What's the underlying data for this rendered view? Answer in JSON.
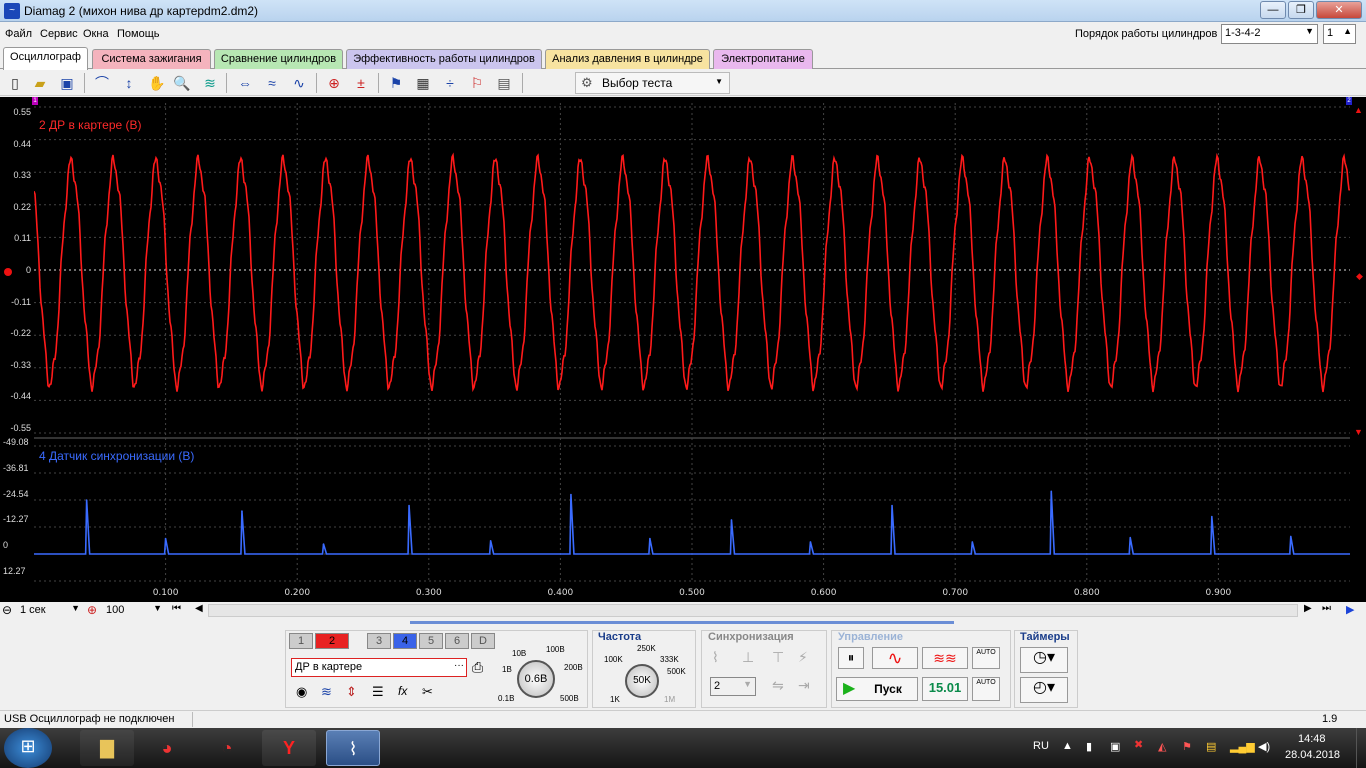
{
  "window": {
    "title": "Diamag 2 (михон нива др картерdm2.dm2)",
    "min_label": "—",
    "max_label": "❐",
    "close_label": "✕"
  },
  "menu": {
    "items": [
      "Файл",
      "Сервис",
      "Окна",
      "Помощь"
    ],
    "cylinder_order_label": "Порядок работы цилиндров",
    "cylinder_order_value": "1-3-4-2",
    "cylinder_number": "1"
  },
  "tabs": [
    {
      "label": "Осциллограф",
      "color": "#ffffff",
      "active": true
    },
    {
      "label": "Система зажигания",
      "color": "#f4b3bd"
    },
    {
      "label": "Сравнение цилиндров",
      "color": "#b7e7b3"
    },
    {
      "label": "Эффективность работы цилиндров",
      "color": "#cbc5ee"
    },
    {
      "label": "Анализ давления в цилиндре",
      "color": "#f7e3a0"
    },
    {
      "label": "Электропитание",
      "color": "#e9b8ee"
    }
  ],
  "toolbar": {
    "test_select": "Выбор теста",
    "icons": [
      "new-file-icon",
      "open-folder-icon",
      "save-icon",
      "channel-scale-icon",
      "cursor-icon",
      "hand-tool-icon",
      "zoom-icon",
      "signal-icon",
      "marker-icon",
      "filter-icon",
      "fft-icon",
      "auto-icon",
      "offset-icon",
      "probe-icon",
      "grid-icon",
      "trigger-icon",
      "flag-icon",
      "page-icon"
    ]
  },
  "scope": {
    "ch2_title": "2 ДР в картере (В)",
    "ch4_title": "4 Датчик синхронизации (В)",
    "ch2_color": "#ff1a1a",
    "ch4_color": "#3a6bff",
    "ch2_y_ticks": [
      "0.55",
      "0.44",
      "0.33",
      "0.22",
      "0.11",
      "0",
      "-0.11",
      "-0.22",
      "-0.33",
      "-0.44",
      "-0.55"
    ],
    "ch4_y_ticks": [
      "-49.08",
      "-36.81",
      "-24.54",
      "-12.27",
      "0",
      "12.27"
    ],
    "x_ticks": [
      "0.100",
      "0.200",
      "0.300",
      "0.400",
      "0.500",
      "0.600",
      "0.700",
      "0.800",
      "0.900"
    ],
    "left_marker": "1",
    "right_marker": "2"
  },
  "chart_data": [
    {
      "type": "line",
      "title": "2 ДР в картере (В)",
      "xlim": [
        0,
        1.0
      ],
      "ylim": [
        -0.55,
        0.55
      ],
      "series": [
        {
          "name": "2 ДР в картере (В)",
          "shape": "sine",
          "cycles": 31,
          "amplitude": 0.37,
          "offset": -0.01
        }
      ]
    },
    {
      "type": "line",
      "title": "4 Датчик синхронизации (В)",
      "xlim": [
        0,
        1.0
      ],
      "ylim": [
        12.27,
        -49.08
      ],
      "series": [
        {
          "name": "4 Датчик синхронизации (В)",
          "pulses": [
            {
              "x": 0.04,
              "y": -24.5
            },
            {
              "x": 0.1,
              "y": -7.0
            },
            {
              "x": 0.158,
              "y": -19.5
            },
            {
              "x": 0.22,
              "y": -4.5
            },
            {
              "x": 0.285,
              "y": -22.0
            },
            {
              "x": 0.347,
              "y": -6.0
            },
            {
              "x": 0.408,
              "y": -27.0
            },
            {
              "x": 0.468,
              "y": -7.0
            },
            {
              "x": 0.53,
              "y": -15.5
            },
            {
              "x": 0.59,
              "y": -5.5
            },
            {
              "x": 0.652,
              "y": -22.0
            },
            {
              "x": 0.713,
              "y": -5.5
            },
            {
              "x": 0.773,
              "y": -28.5
            },
            {
              "x": 0.833,
              "y": -7.5
            },
            {
              "x": 0.895,
              "y": -17.0
            },
            {
              "x": 0.955,
              "y": -8.0
            }
          ]
        }
      ]
    }
  ],
  "time": {
    "timebase": "1 сек",
    "samples": "100"
  },
  "channels": {
    "buttons": [
      "1",
      "2",
      "3",
      "4",
      "5",
      "6",
      "D"
    ],
    "active_red": "2",
    "active_blue": "4",
    "name_field": "ДР в картере",
    "voltage_value": "0.6В",
    "voltage_labels": [
      "10В",
      "100В",
      "1В",
      "200В",
      "0.1В",
      "500В"
    ]
  },
  "frequency": {
    "title": "Частота",
    "value": "50K",
    "labels": [
      "100K",
      "250K",
      "333K",
      "500K",
      "1K",
      "1M"
    ]
  },
  "sync": {
    "title": "Синхронизация",
    "channel": "2"
  },
  "control": {
    "title": "Управление",
    "start_label": "Пуск",
    "value": "15.01",
    "auto_label": "AUTO"
  },
  "timers": {
    "title": "Таймеры"
  },
  "status": {
    "text": "USB Осциллограф не подключен",
    "version": "1.9"
  },
  "taskbar": {
    "lang": "RU",
    "time": "14:48",
    "date": "28.04.2018"
  }
}
